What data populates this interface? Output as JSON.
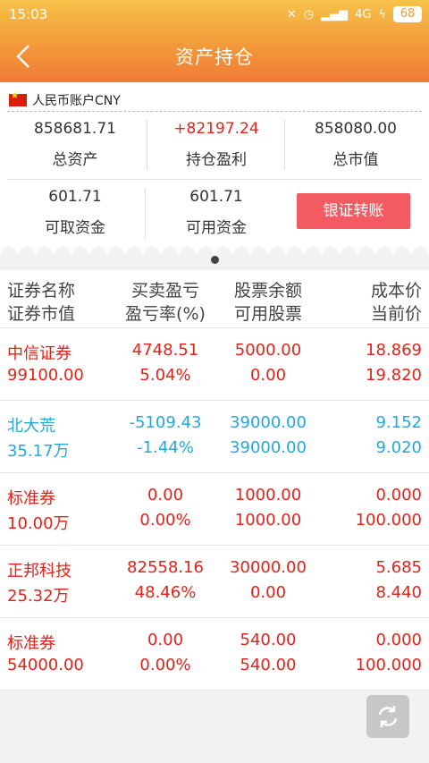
{
  "status": {
    "time": "15:03",
    "network": "4G",
    "battery": "68"
  },
  "header": {
    "title": "资产持仓"
  },
  "account": {
    "label": "人民币账户CNY",
    "total_assets": {
      "value": "858681.71",
      "label": "总资产"
    },
    "position_pnl": {
      "value": "+82197.24",
      "label": "持仓盈利"
    },
    "market_value": {
      "value": "858080.00",
      "label": "总市值"
    },
    "withdrawable": {
      "value": "601.71",
      "label": "可取资金"
    },
    "available": {
      "value": "601.71",
      "label": "可用资金"
    },
    "transfer_button": "银证转账"
  },
  "table": {
    "headers": [
      [
        "证券名称",
        "证券市值"
      ],
      [
        "买卖盈亏",
        "盈亏率(%)"
      ],
      [
        "股票余额",
        "可用股票"
      ],
      [
        "成本价",
        "当前价"
      ]
    ],
    "rows": [
      {
        "name": "中信证券",
        "value": "99100.00",
        "pnl": "4748.51",
        "pnl_rate": "5.04%",
        "balance": "5000.00",
        "available": "0.00",
        "cost": "18.869",
        "price": "19.820",
        "color": "red"
      },
      {
        "name": "北大荒",
        "value": "35.17万",
        "pnl": "-5109.43",
        "pnl_rate": "-1.44%",
        "balance": "39000.00",
        "available": "39000.00",
        "cost": "9.152",
        "price": "9.020",
        "color": "blue"
      },
      {
        "name": "标准券",
        "value": "10.00万",
        "pnl": "0.00",
        "pnl_rate": "0.00%",
        "balance": "1000.00",
        "available": "1000.00",
        "cost": "0.000",
        "price": "100.000",
        "color": "red"
      },
      {
        "name": "正邦科技",
        "value": "25.32万",
        "pnl": "82558.16",
        "pnl_rate": "48.46%",
        "balance": "30000.00",
        "available": "0.00",
        "cost": "5.685",
        "price": "8.440",
        "color": "red"
      },
      {
        "name": "标准券",
        "value": "54000.00",
        "pnl": "0.00",
        "pnl_rate": "0.00%",
        "balance": "540.00",
        "available": "540.00",
        "cost": "0.000",
        "price": "100.000",
        "color": "red"
      }
    ]
  },
  "colors": {
    "accent": "#f39a3a",
    "gain": "#e2231a",
    "loss": "#25a7d8",
    "button": "#f35a62"
  }
}
